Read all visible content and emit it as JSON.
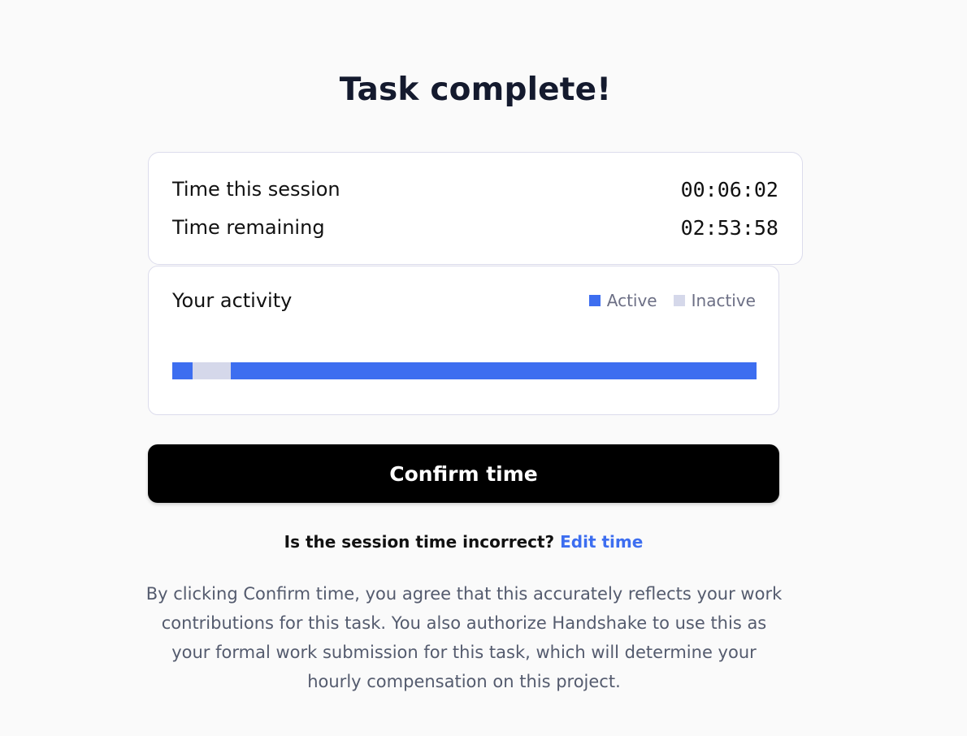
{
  "header": {
    "title": "Task complete!"
  },
  "time_summary": {
    "rows": [
      {
        "label": "Time this session",
        "value": "00:06:02"
      },
      {
        "label": "Time remaining",
        "value": "02:53:58"
      }
    ]
  },
  "activity": {
    "title": "Your activity",
    "legend": [
      {
        "label": "Active",
        "color": "#3d6ef0"
      },
      {
        "label": "Inactive",
        "color": "#d5d8ea"
      }
    ],
    "segments": [
      {
        "state": "active",
        "fraction": 0.035
      },
      {
        "state": "inactive",
        "fraction": 0.065
      },
      {
        "state": "active",
        "fraction": 0.9
      }
    ]
  },
  "actions": {
    "confirm_label": "Confirm time",
    "incorrect_question": "Is the session time incorrect?",
    "edit_link": "Edit time"
  },
  "disclaimer": "By clicking Confirm time, you agree that this accurately reflects your work contributions for this task. You also authorize Handshake to use this as your formal work submission for this task, which will determine your hourly compensation on this project.",
  "colors": {
    "active": "#3d6ef0",
    "inactive": "#d5d8ea",
    "link": "#3d6ef0",
    "button_bg": "#000000"
  }
}
